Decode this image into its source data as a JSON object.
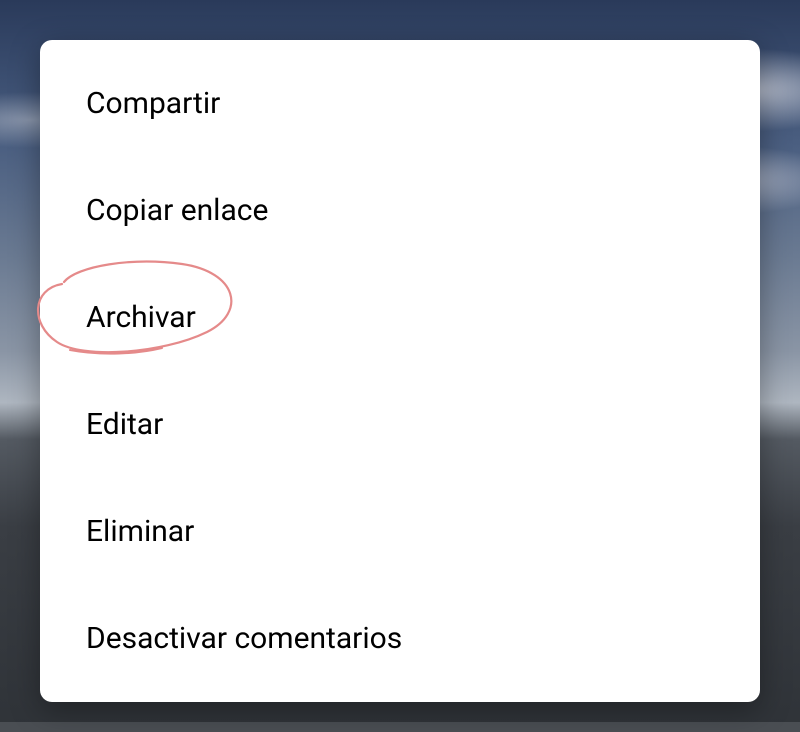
{
  "menu": {
    "items": [
      {
        "label": "Compartir",
        "name": "menu-item-share"
      },
      {
        "label": "Copiar enlace",
        "name": "menu-item-copy-link"
      },
      {
        "label": "Archivar",
        "name": "menu-item-archive"
      },
      {
        "label": "Editar",
        "name": "menu-item-edit"
      },
      {
        "label": "Eliminar",
        "name": "menu-item-delete"
      },
      {
        "label": "Desactivar comentarios",
        "name": "menu-item-disable-comments"
      }
    ]
  },
  "annotation": {
    "target_name": "menu-item-archive",
    "stroke_color": "#e58a8a"
  }
}
